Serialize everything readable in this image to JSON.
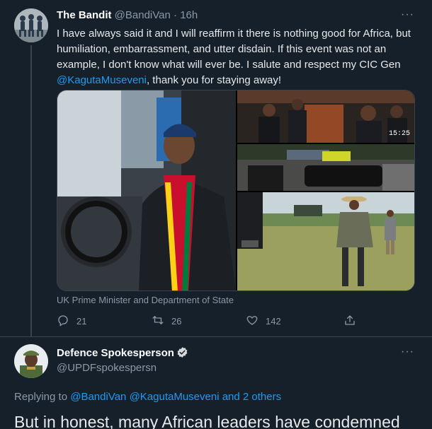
{
  "tweet1": {
    "display_name": "The Bandit",
    "handle": "@BandiVan",
    "separator": "·",
    "time": "16h",
    "more_label": "···",
    "text_before": "I have always said it and I will reaffirm it there is nothing good for Africa, but humiliation, embarrassment, and utter disdain. If this event was not an example, I don't know what will ever be. I salute and respect my CIC Gen ",
    "mention": "@KagutaMuseveni",
    "text_after": ", thank you for staying away!",
    "media_overlay_time": "15:25",
    "media_caption": "UK Prime Minister and Department of State",
    "replies": "21",
    "retweets": "26",
    "likes": "142"
  },
  "tweet2": {
    "display_name": "Defence Spokesperson",
    "handle": "@UPDFspokespersn",
    "more_label": "···",
    "replying_label": "Replying to",
    "reply_mention_1": "@BandiVan",
    "reply_mention_2": "@KagutaMuseveni",
    "reply_others": "and 2 others",
    "text_preview": "But in honest, many African leaders have condemned"
  },
  "colors": {
    "background": "#15202b",
    "accent": "#1d9bf0",
    "secondary_text": "#8b98a5",
    "divider": "#38444d"
  },
  "icons": [
    "reply-icon",
    "retweet-icon",
    "like-icon",
    "share-icon",
    "verified-badge-icon",
    "more-icon"
  ]
}
